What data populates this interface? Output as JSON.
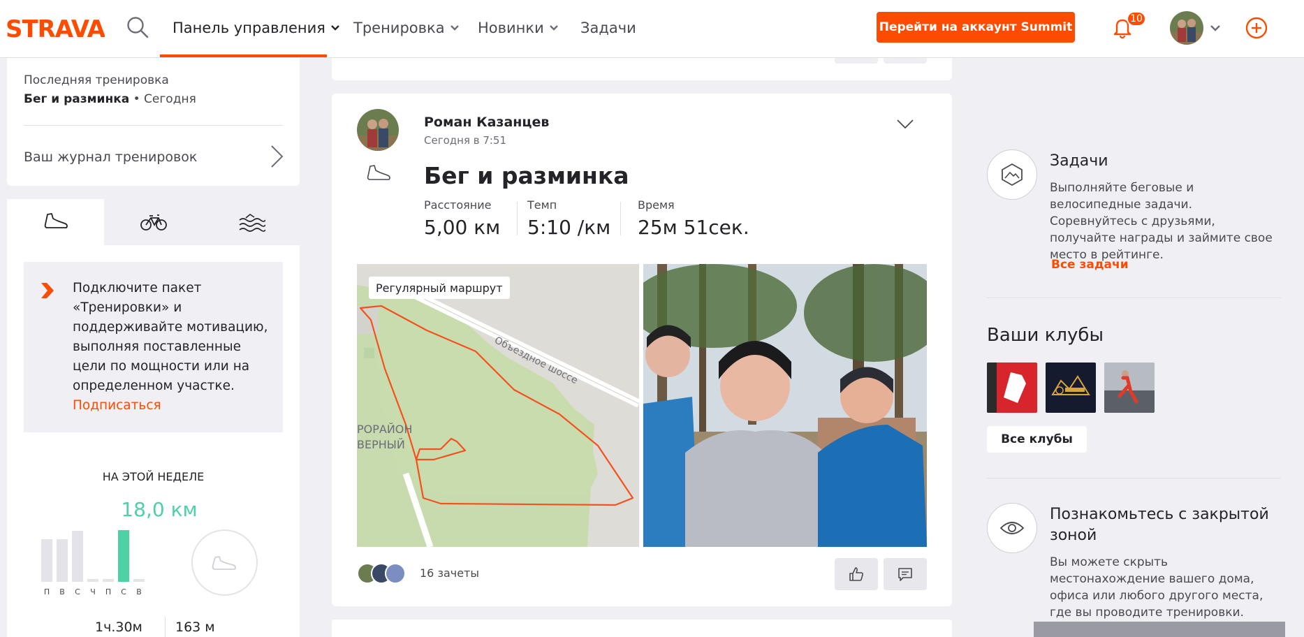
{
  "brand": {
    "logo_text": "STRAVA",
    "accent": "#fc4c02",
    "accent_green": "#4fd1a4"
  },
  "nav": {
    "items": [
      {
        "label": "Панель управления",
        "active": true,
        "has_dropdown": true
      },
      {
        "label": "Тренировка",
        "active": false,
        "has_dropdown": true
      },
      {
        "label": "Новинки",
        "active": false,
        "has_dropdown": true
      },
      {
        "label": "Задачи",
        "active": false,
        "has_dropdown": false
      }
    ],
    "summit_button": "Перейти на аккаунт Summit",
    "notifications_count": "10",
    "icons": [
      "search-icon",
      "bell-icon",
      "plus-circle-icon"
    ]
  },
  "left": {
    "last_activity_label": "Последняя тренировка",
    "last_activity_name": "Бег и разминка",
    "last_activity_when": " • Сегодня",
    "journal_link": "Ваш журнал тренировок",
    "sport_tabs": [
      "run-shoe-icon",
      "bike-icon",
      "swim-icon"
    ],
    "promo_text": "Подключите пакет «Тренировки» и поддерживайте мотивацию, выполняя поставленные цели по мощности или на определенном участке.",
    "promo_link": "Подписаться",
    "week_title": "НА ЭТОЙ НЕДЕЛЕ",
    "week_distance": "18,0 км",
    "week_days": [
      "П",
      "В",
      "С",
      "Ч",
      "П",
      "С",
      "В"
    ],
    "week_levels": [
      0.82,
      0.82,
      0.98,
      0.05,
      0.05,
      1.0,
      0.05
    ],
    "week_highlight_index": 5,
    "week_time": "1ч.30м",
    "week_elev": "163 м"
  },
  "feed": {
    "athlete": "Роман Казанцев",
    "time": "Сегодня в 7:51",
    "title": "Бег и разминка",
    "stats": [
      {
        "label": "Расстояние",
        "value": "5,00 км"
      },
      {
        "label": "Темп",
        "value": "5:10 /км"
      },
      {
        "label": "Время",
        "value": "25м 51сек."
      }
    ],
    "map_badge": "Регулярный маршрут",
    "map_road": "Объездное шоссе",
    "map_district_1": "РОРАЙОН",
    "map_district_2": "ВЕРНЫЙ",
    "kudos": "16 зачеты"
  },
  "right": {
    "challenges_title": "Задачи",
    "challenges_text": "Выполняйте беговые и велосипедные задачи. Соревнуйтесь с друзьями, получайте награды и займите свое место в рейтинге.",
    "challenges_link": "Все задачи",
    "clubs_title": "Ваши клубы",
    "clubs_button": "Все клубы",
    "privacy_title": "Познакомьтесь с закрытой зоной",
    "privacy_text": "Вы можете скрыть местонахождение вашего дома, офиса или любого другого места, где вы проводите тренировки."
  }
}
